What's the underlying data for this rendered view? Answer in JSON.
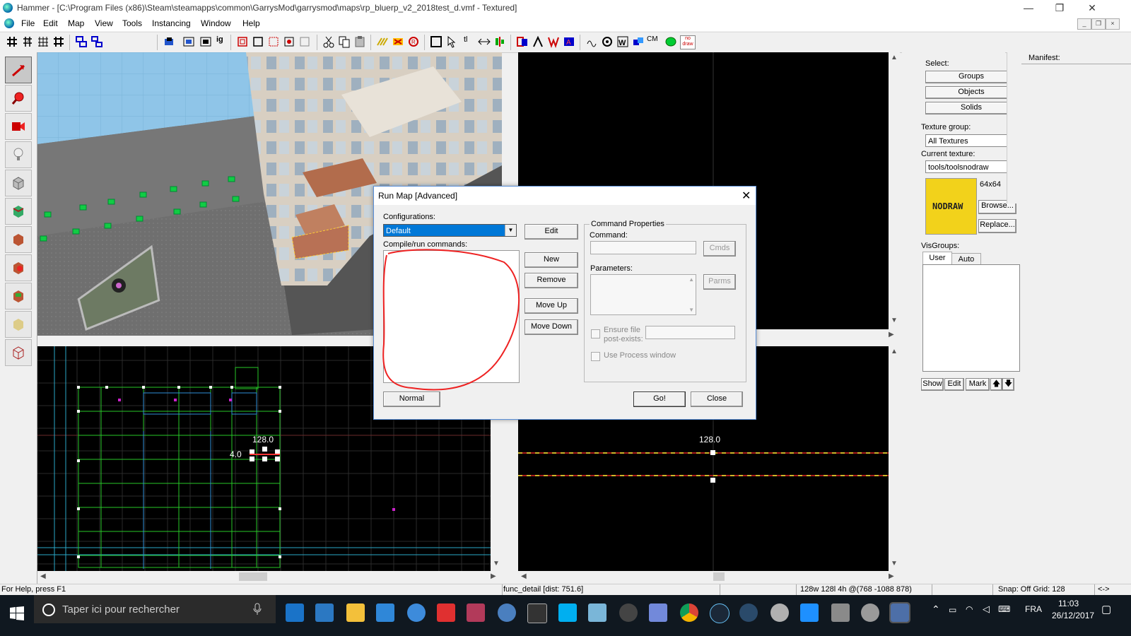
{
  "window": {
    "title": "Hammer - [C:\\Program Files (x86)\\Steam\\steamapps\\common\\GarrysMod\\garrysmod\\maps\\rp_bluerp_v2_2018test_d.vmf - Textured]",
    "minimize": "—",
    "maximize": "❐",
    "close": "✕"
  },
  "menu": [
    "File",
    "Edit",
    "Map",
    "View",
    "Tools",
    "Instancing",
    "Window",
    "Help"
  ],
  "toolbar": {
    "cm_label": "CM",
    "nodraw_label": "no draw",
    "ig_label": "ig",
    "t_label": "tl"
  },
  "viewport_2d_left": {
    "label_top": "128.0",
    "label_left": "4.0"
  },
  "viewport_2d_right": {
    "label_top": "128.0"
  },
  "right_panel": {
    "select_label": "Select:",
    "groups": "Groups",
    "objects": "Objects",
    "solids": "Solids",
    "texture_group_label": "Texture group:",
    "texture_group_value": "All Textures",
    "current_texture_label": "Current texture:",
    "current_texture_value": "tools/toolsnodraw",
    "texture_preview_text": "NODRAW",
    "texture_size": "64x64",
    "browse": "Browse...",
    "replace": "Replace...",
    "visgroups_label": "VisGroups:",
    "tab_user": "User",
    "tab_auto": "Auto",
    "show": "Show",
    "edit": "Edit",
    "mark": "Mark",
    "up": "🡅",
    "down": "🡇"
  },
  "manifest": {
    "label": "Manifest:"
  },
  "dialog": {
    "title": "Run Map [Advanced]",
    "configurations_label": "Configurations:",
    "configuration_value": "Default",
    "edit": "Edit",
    "compile_label": "Compile/run commands:",
    "new": "New",
    "remove": "Remove",
    "move_up": "Move Up",
    "move_down": "Move Down",
    "command_properties": "Command Properties",
    "command_label": "Command:",
    "cmds": "Cmds",
    "parameters_label": "Parameters:",
    "parms": "Parms",
    "ensure_file": "Ensure file post-exists:",
    "use_process": "Use Process window",
    "normal": "Normal",
    "go": "Go!",
    "close": "Close"
  },
  "status": {
    "help": "For Help, press F1",
    "object": "func_detail  [dist: 751.6]",
    "size": "128w 128l 4h @(768 -1088 878)",
    "snap": "Snap: Off Grid: 128",
    "nav": "<->"
  },
  "taskbar": {
    "search_placeholder": "Taper ici pour rechercher",
    "lang": "FRA",
    "time": "11:03",
    "date": "26/12/2017"
  },
  "colors": {
    "accent": "#0078d7",
    "texture_yellow": "#f2d21b",
    "taskbar": "#101820"
  }
}
